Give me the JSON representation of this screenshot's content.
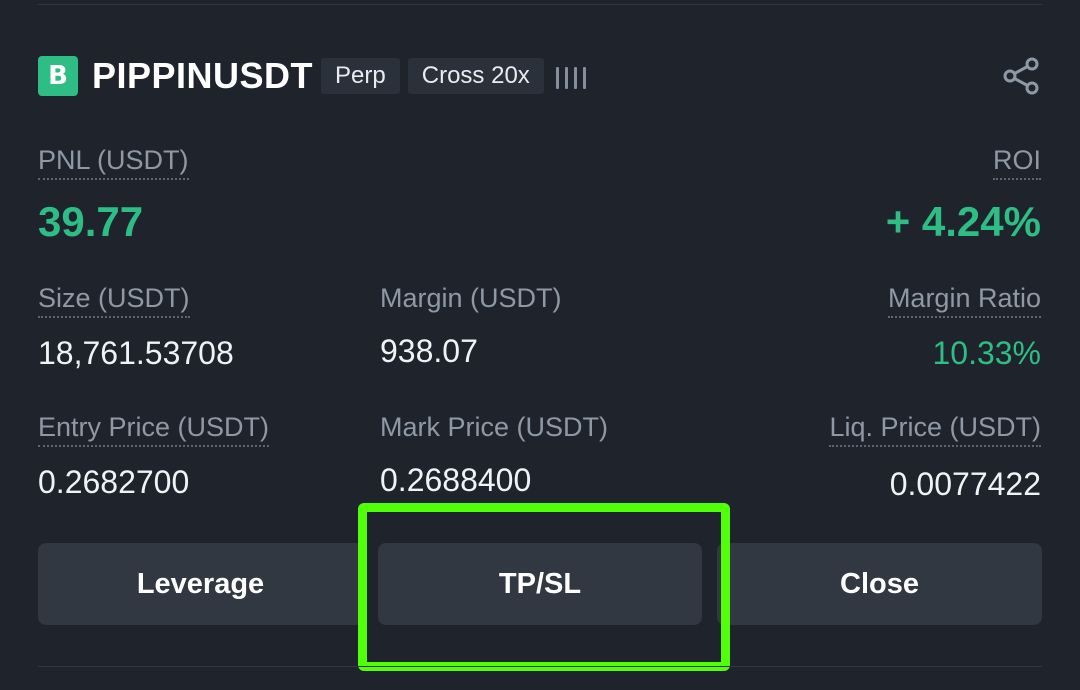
{
  "position": {
    "side_badge": "B",
    "symbol": "PIPPINUSDT",
    "tags": [
      "Perp",
      "Cross 20x"
    ],
    "signal_icon": "signal-bars-icon",
    "share_icon": "share-icon"
  },
  "pnl": {
    "label": "PNL (USDT)",
    "value": "39.77"
  },
  "roi": {
    "label": "ROI",
    "value": "+ 4.24%"
  },
  "stats": {
    "size_label": "Size (USDT)",
    "size_value": "18,761.53708",
    "margin_label": "Margin (USDT)",
    "margin_value": "938.07",
    "margin_ratio_label": "Margin Ratio",
    "margin_ratio_value": "10.33%",
    "entry_label": "Entry Price (USDT)",
    "entry_value": "0.2682700",
    "mark_label": "Mark Price (USDT)",
    "mark_value": "0.2688400",
    "liq_label": "Liq. Price (USDT)",
    "liq_value": "0.0077422"
  },
  "actions": {
    "leverage": "Leverage",
    "tpsl": "TP/SL",
    "close": "Close"
  },
  "colors": {
    "background": "#1f242c",
    "positive": "#2ebd85",
    "highlight": "#51ff0a",
    "button": "#323842"
  }
}
